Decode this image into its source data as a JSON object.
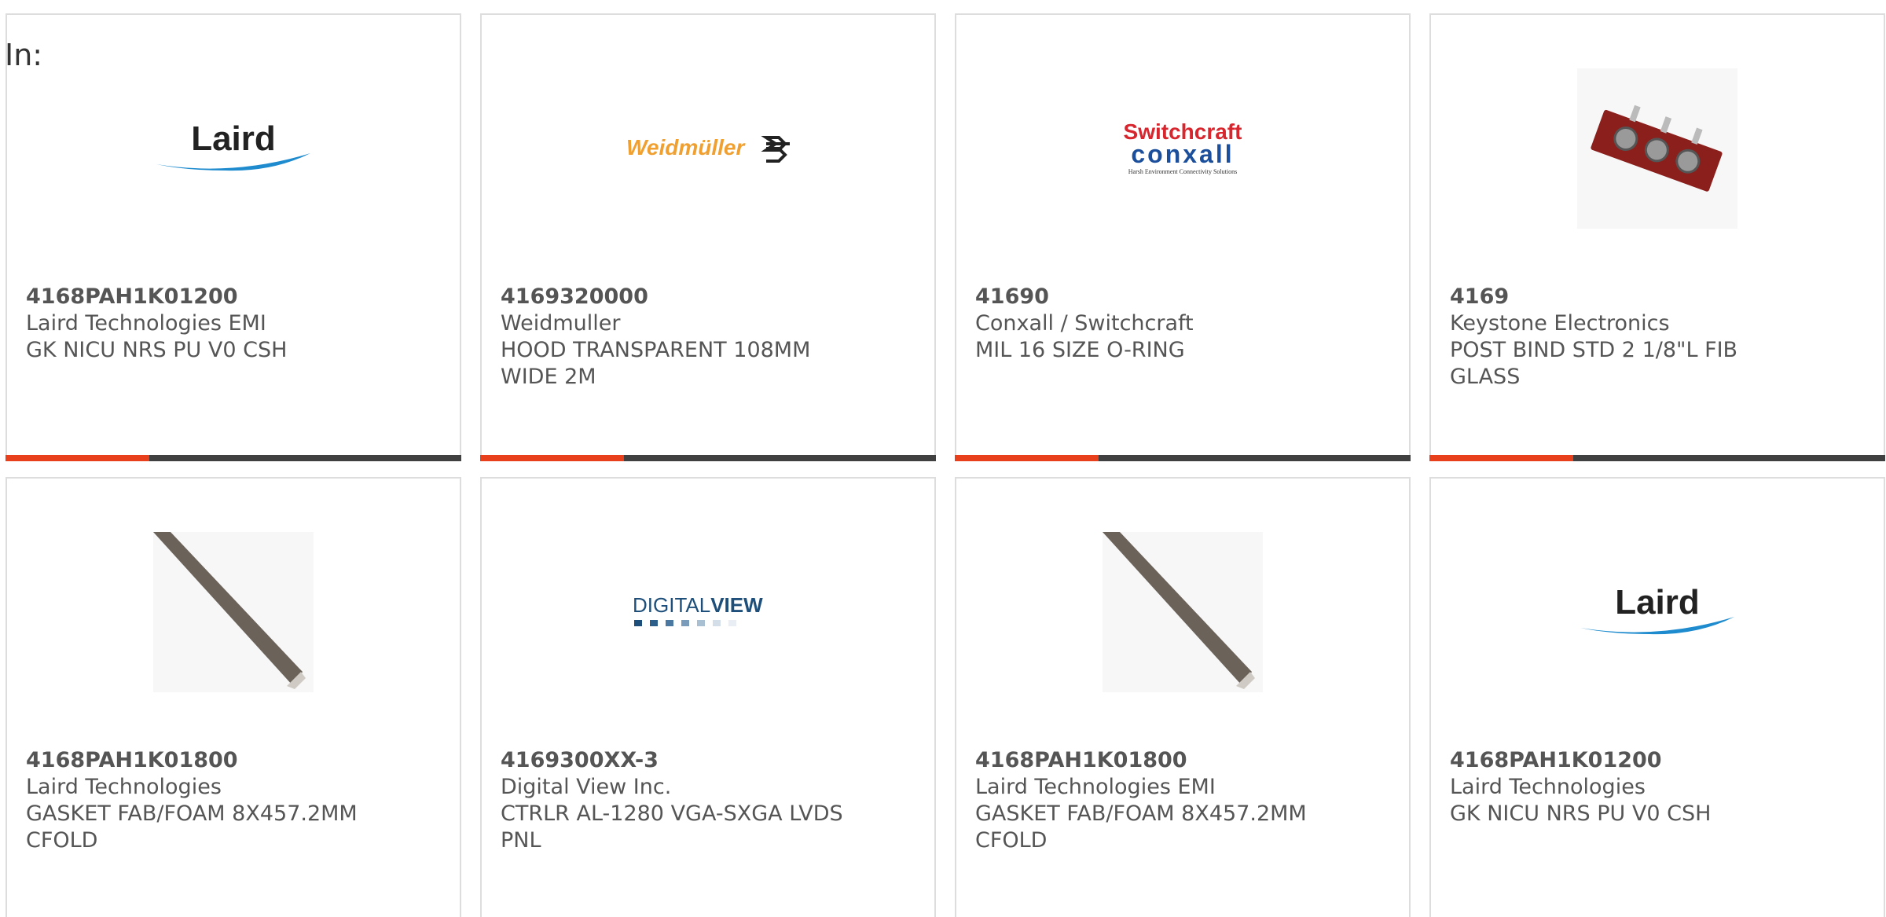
{
  "header": {
    "label": "In:"
  },
  "colors": {
    "accent": "#e8401c",
    "bar": "#404040",
    "border": "#dddddd",
    "text": "#555555"
  },
  "products": [
    {
      "part": "4168PAH1K01200",
      "maker": "Laird Technologies EMI",
      "desc": "GK NICU NRS PU V0 CSH",
      "image": "laird-logo",
      "logo_text": "Laird"
    },
    {
      "part": "4169320000",
      "maker": "Weidmuller",
      "desc": "HOOD TRANSPARENT 108MM\nWIDE 2M",
      "image": "weidmuller-logo",
      "logo_text": "Weidmüller"
    },
    {
      "part": "41690",
      "maker": "Conxall / Switchcraft",
      "desc": "MIL 16 SIZE O-RING",
      "image": "switchcraft-conxall-logo",
      "logo_text": "Switchcraft",
      "logo_text2": "conxall",
      "logo_tagline": "Harsh Environment Connectivity Solutions"
    },
    {
      "part": "4169",
      "maker": "Keystone Electronics",
      "desc": "POST BIND STD 2 1/8\"L FIB\nGLASS",
      "image": "binding-post-photo"
    },
    {
      "part": "4168PAH1K01800",
      "maker": "Laird Technologies",
      "desc": "GASKET FAB/FOAM 8X457.2MM\nCFOLD",
      "image": "gasket-photo"
    },
    {
      "part": "4169300XX-3",
      "maker": "Digital View Inc.",
      "desc": "CTRLR AL-1280 VGA-SXGA LVDS\nPNL",
      "image": "digitalview-logo",
      "logo_text": "DIGITAL",
      "logo_text2": "VIEW"
    },
    {
      "part": "4168PAH1K01800",
      "maker": "Laird Technologies EMI",
      "desc": "GASKET FAB/FOAM 8X457.2MM\nCFOLD",
      "image": "gasket-photo"
    },
    {
      "part": "4168PAH1K01200",
      "maker": "Laird Technologies",
      "desc": "GK NICU NRS PU V0 CSH",
      "image": "laird-logo",
      "logo_text": "Laird"
    }
  ]
}
